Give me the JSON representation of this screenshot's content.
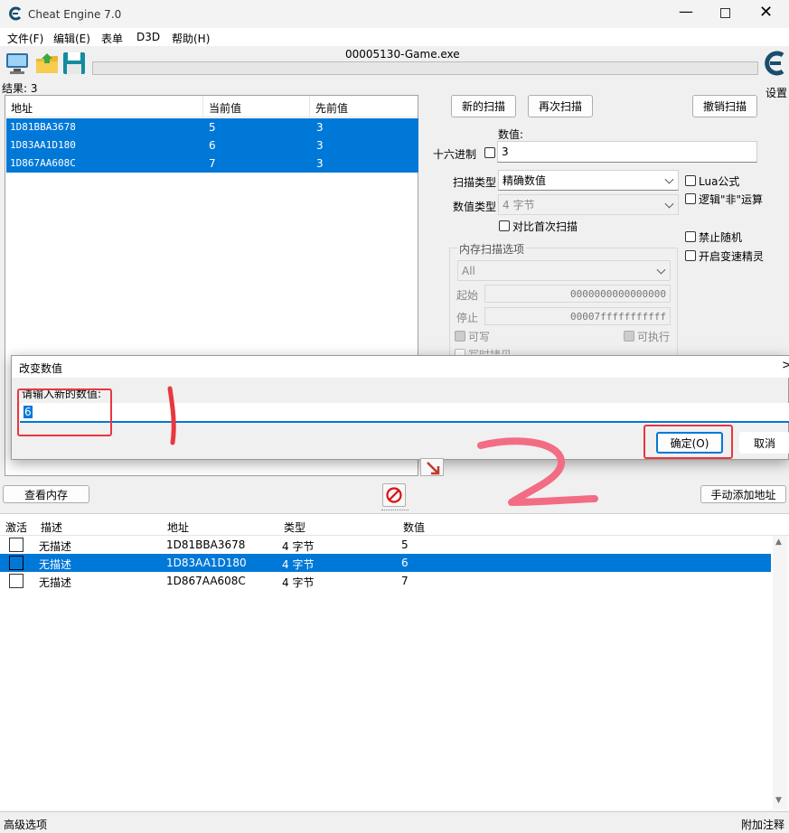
{
  "window": {
    "title": "Cheat Engine 7.0",
    "process": "00005130-Game.exe",
    "settings": "设置"
  },
  "menu": [
    "文件(F)",
    "编辑(E)",
    "表单",
    "D3D",
    "帮助(H)"
  ],
  "results_label": "结果: 3",
  "scan_list": {
    "headers": [
      "地址",
      "当前值",
      "先前值"
    ],
    "rows": [
      {
        "addr": "1D81BBA3678",
        "cur": "5",
        "prev": "3"
      },
      {
        "addr": "1D83AA1D180",
        "cur": "6",
        "prev": "3"
      },
      {
        "addr": "1D867AA608C",
        "cur": "7",
        "prev": "3"
      }
    ]
  },
  "scan": {
    "new_scan": "新的扫描",
    "next_scan": "再次扫描",
    "undo_scan": "撤销扫描",
    "value_label": "数值:",
    "hex_label": "十六进制",
    "value": "3",
    "scan_type_label": "扫描类型",
    "scan_type": "精确数值",
    "value_type_label": "数值类型",
    "value_type": "4 字节",
    "compare_first": "对比首次扫描",
    "lua": "Lua公式",
    "not_op": "逻辑\"非\"运算",
    "no_random": "禁止随机",
    "speedhack": "开启变速精灵",
    "mem_options": "内存扫描选项",
    "mem_region": "All",
    "start_label": "起始",
    "start": "0000000000000000",
    "stop_label": "停止",
    "stop": "00007fffffffffff",
    "writable": "可写",
    "executable": "可执行",
    "copy_on_write": "写时拷贝"
  },
  "dialog": {
    "title": "改变数值",
    "prompt": "请输入新的数值:",
    "value": "6",
    "ok": "确定(O)",
    "cancel": "取消"
  },
  "buttons": {
    "view_memory": "查看内存",
    "add_manual": "手动添加地址"
  },
  "address_list": {
    "headers": [
      "激活",
      "描述",
      "地址",
      "类型",
      "数值"
    ],
    "rows": [
      {
        "desc": "无描述",
        "addr": "1D81BBA3678",
        "type": "4 字节",
        "value": "5"
      },
      {
        "desc": "无描述",
        "addr": "1D83AA1D180",
        "type": "4 字节",
        "value": "6"
      },
      {
        "desc": "无描述",
        "addr": "1D867AA608C",
        "type": "4 字节",
        "value": "7"
      }
    ]
  },
  "statusbar": {
    "left": "高级选项",
    "right": "附加注释"
  },
  "colors": {
    "selection": "#0078d7",
    "annotation": "#e8373d"
  }
}
